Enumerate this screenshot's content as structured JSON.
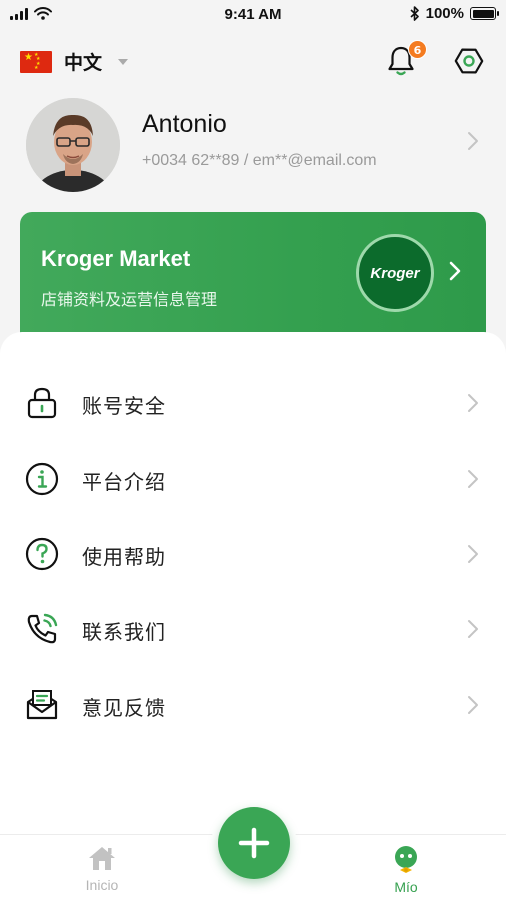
{
  "status_bar": {
    "time": "9:41 AM",
    "battery": "100%"
  },
  "header": {
    "language": "中文",
    "notification_count": "6"
  },
  "profile": {
    "name": "Antonio",
    "contact": "+0034 62**89 / em**@email.com"
  },
  "store_card": {
    "name": "Kroger Market",
    "subtitle": "店铺资料及运营信息管理",
    "logo_text": "Kroger"
  },
  "menu": {
    "items": [
      {
        "label": "账号安全",
        "icon": "lock-icon"
      },
      {
        "label": "平台介绍",
        "icon": "info-icon"
      },
      {
        "label": "使用帮助",
        "icon": "help-icon"
      },
      {
        "label": "联系我们",
        "icon": "phone-icon"
      },
      {
        "label": "意见反馈",
        "icon": "feedback-icon"
      }
    ]
  },
  "tabbar": {
    "home_label": "Inicio",
    "mio_label": "Mío"
  },
  "colors": {
    "brand_green": "#3aa655",
    "badge_orange": "#f47b20",
    "muted_text": "#9a9a9a"
  }
}
